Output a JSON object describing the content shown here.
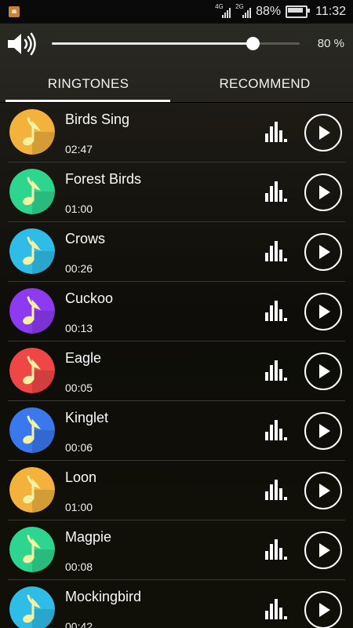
{
  "status_bar": {
    "net1": "4G",
    "net2": "2G",
    "battery_pct": "88%",
    "time": "11:32"
  },
  "volume": {
    "percent_label": "80 %",
    "level": 0.81
  },
  "tabs": [
    {
      "label": "RINGTONES",
      "active": true
    },
    {
      "label": "RECOMMEND",
      "active": false
    }
  ],
  "ringtones": [
    {
      "name": "Birds Sing",
      "duration": "02:47",
      "color": "#f2b23c"
    },
    {
      "name": "Forest Birds",
      "duration": "01:00",
      "color": "#2ed58f"
    },
    {
      "name": "Crows",
      "duration": "00:26",
      "color": "#2fbde8"
    },
    {
      "name": "Cuckoo",
      "duration": "00:13",
      "color": "#8d3af0"
    },
    {
      "name": "Eagle",
      "duration": "00:05",
      "color": "#ef4646"
    },
    {
      "name": "Kinglet",
      "duration": "00:06",
      "color": "#3a78ee"
    },
    {
      "name": "Loon",
      "duration": "01:00",
      "color": "#f2b23c"
    },
    {
      "name": "Magpie",
      "duration": "00:08",
      "color": "#2ed58f"
    },
    {
      "name": "Mockingbird",
      "duration": "00:42",
      "color": "#2fbde8"
    }
  ]
}
